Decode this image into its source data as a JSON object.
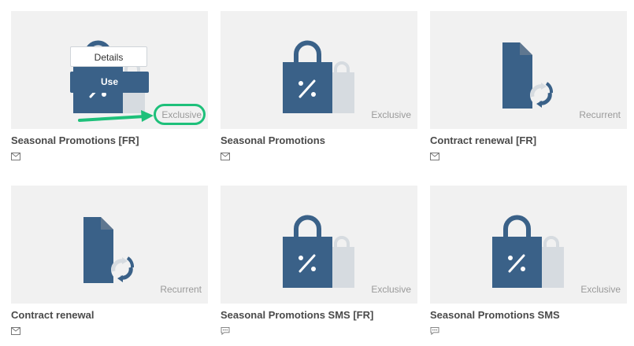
{
  "cards": [
    {
      "title": "Seasonal Promotions [FR]",
      "tag": "Exclusive",
      "icon": "shopping-bag-percent-icon",
      "channel": "email-icon"
    },
    {
      "title": "Seasonal Promotions",
      "tag": "Exclusive",
      "icon": "shopping-bag-percent-icon",
      "channel": "email-icon"
    },
    {
      "title": "Contract renewal [FR]",
      "tag": "Recurrent",
      "icon": "document-refresh-icon",
      "channel": "email-icon"
    },
    {
      "title": "Contract renewal",
      "tag": "Recurrent",
      "icon": "document-refresh-icon",
      "channel": "email-icon"
    },
    {
      "title": "Seasonal Promotions SMS [FR]",
      "tag": "Exclusive",
      "icon": "shopping-bag-percent-icon",
      "channel": "sms-icon"
    },
    {
      "title": "Seasonal Promotions SMS",
      "tag": "Exclusive",
      "icon": "shopping-bag-percent-icon",
      "channel": "sms-icon"
    }
  ],
  "hover_actions": {
    "details_label": "Details",
    "use_label": "Use"
  },
  "colors": {
    "accent": "#3a6188",
    "highlight": "#1ec07a",
    "card_bg": "#f1f1f1"
  }
}
